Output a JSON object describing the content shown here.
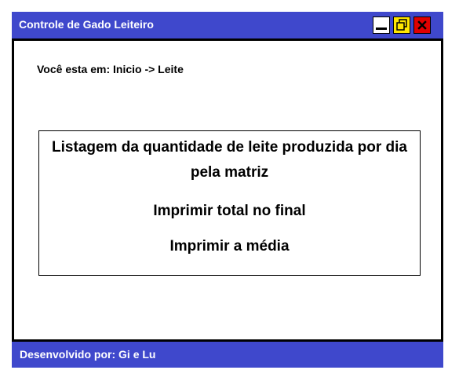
{
  "window": {
    "title": "Controle de Gado Leiteiro",
    "controls": {
      "minimize_icon": "minimize-icon",
      "maximize_icon": "restore-icon",
      "close_icon": "close-icon"
    }
  },
  "colors": {
    "frame": "#3f48cc",
    "minimize_bg": "#ffffff",
    "maximize_bg": "#ffe600",
    "close_bg": "#e00000"
  },
  "breadcrumb": "Você esta em: Inicio -> Leite",
  "menu": {
    "items": [
      {
        "label": "Listagem da quantidade de leite produzida por dia pela matriz"
      },
      {
        "label": "Imprimir total no final"
      },
      {
        "label": "Imprimir a média"
      }
    ]
  },
  "footer": {
    "text": "Desenvolvido por: Gi e Lu"
  }
}
